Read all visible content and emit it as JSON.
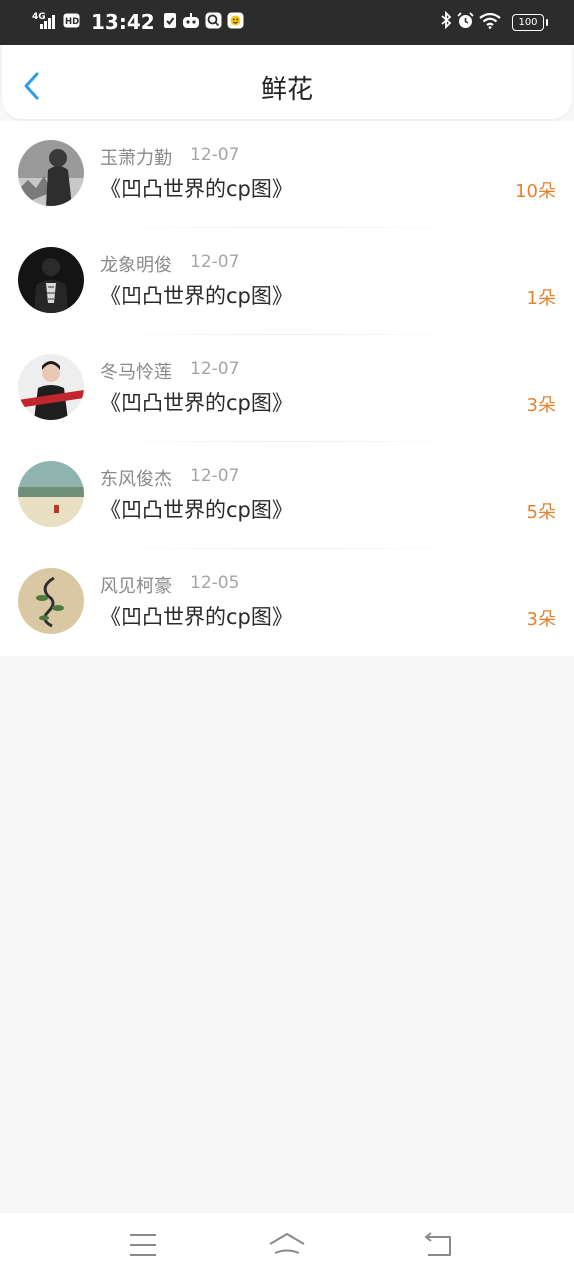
{
  "status_bar": {
    "network": "4G",
    "hd": "HD",
    "time": "13:42",
    "battery": "100",
    "icons": [
      "signal-icon",
      "hd-icon",
      "shield-check-icon",
      "robot-icon",
      "search-app-icon",
      "emoji-app-icon",
      "bluetooth-icon",
      "alarm-icon",
      "wifi-icon",
      "battery-icon"
    ]
  },
  "header": {
    "title": "鲜花",
    "back_icon": "chevron-left-icon",
    "accent": "#2b9ee6"
  },
  "list": {
    "items": [
      {
        "name": "玉萧力勤",
        "date": "12-07",
        "title": "《凹凸世界的cp图》",
        "count": "10朵"
      },
      {
        "name": "龙象明俊",
        "date": "12-07",
        "title": "《凹凸世界的cp图》",
        "count": "1朵"
      },
      {
        "name": "冬马怜莲",
        "date": "12-07",
        "title": "《凹凸世界的cp图》",
        "count": "3朵"
      },
      {
        "name": "东风俊杰",
        "date": "12-07",
        "title": "《凹凸世界的cp图》",
        "count": "5朵"
      },
      {
        "name": "风见柯豪",
        "date": "12-05",
        "title": "《凹凸世界的cp图》",
        "count": "3朵"
      }
    ],
    "count_color": "#e3822f"
  },
  "nav_bar": {
    "icons": [
      "menu-icon",
      "home-icon",
      "back-icon"
    ]
  }
}
